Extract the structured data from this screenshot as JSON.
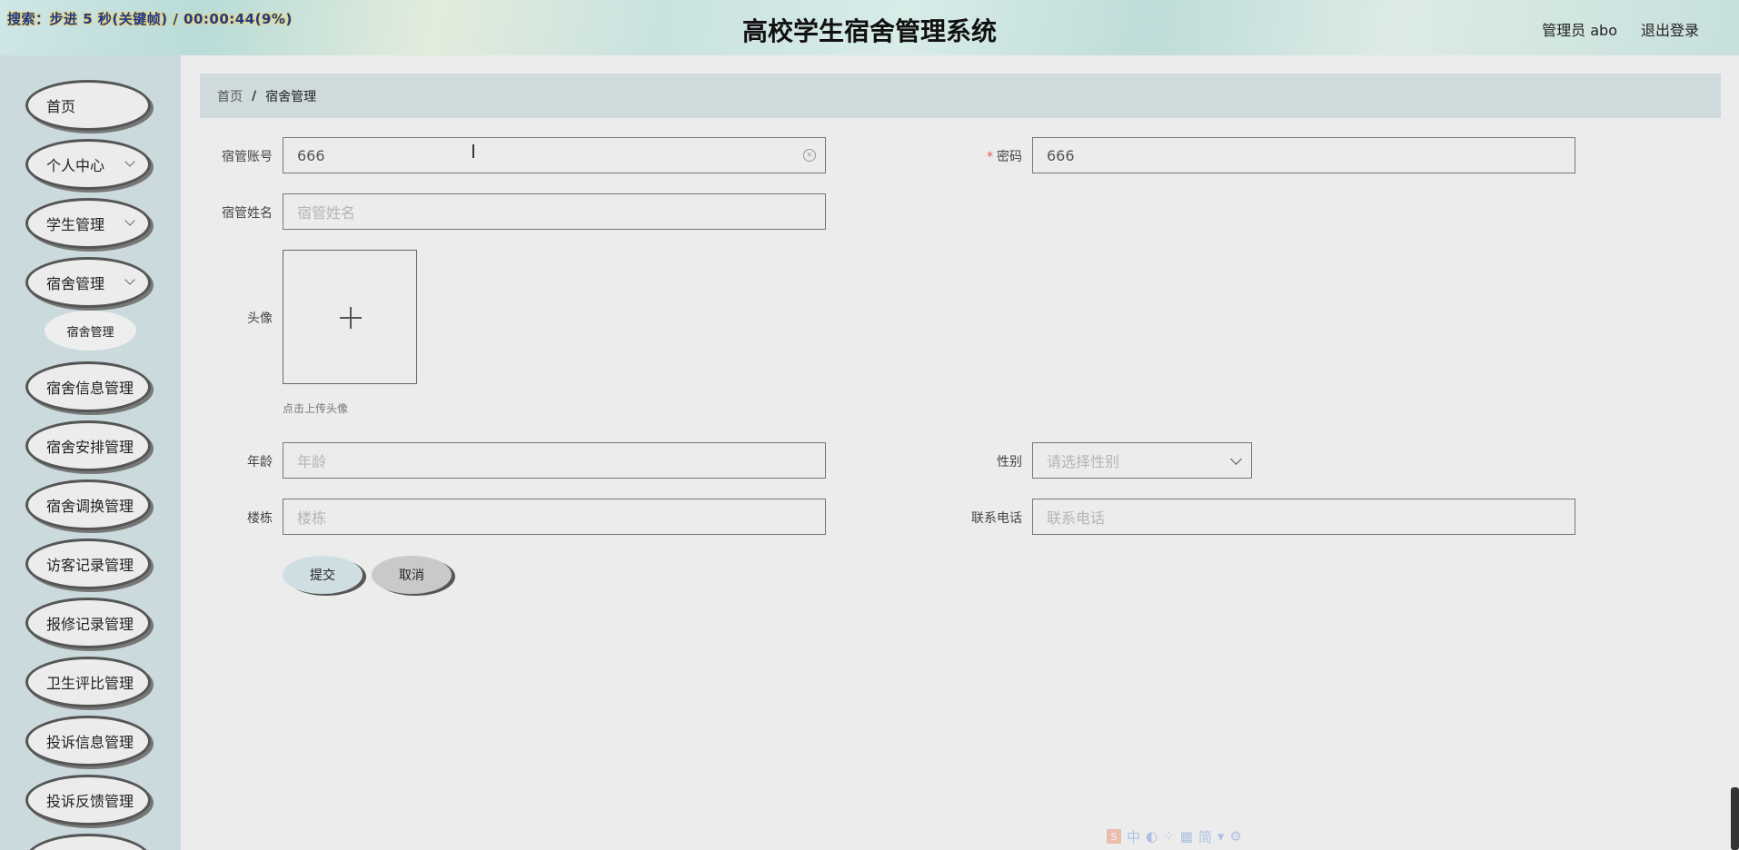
{
  "header": {
    "recorder_text": "搜索：步进 5 秒(关键帧) / 00:00:44(9%)",
    "title": "高校学生宿舍管理系统",
    "user": "管理员 abo",
    "logout": "退出登录"
  },
  "sidebar": {
    "items": [
      {
        "label": "首页"
      },
      {
        "label": "个人中心"
      },
      {
        "label": "学生管理"
      },
      {
        "label": "宿舍管理"
      },
      {
        "label": "宿舍信息管理"
      },
      {
        "label": "宿舍安排管理"
      },
      {
        "label": "宿舍调换管理"
      },
      {
        "label": "访客记录管理"
      },
      {
        "label": "报修记录管理"
      },
      {
        "label": "卫生评比管理"
      },
      {
        "label": "投诉信息管理"
      },
      {
        "label": "投诉反馈管理"
      }
    ],
    "submenu_label": "宿舍管理"
  },
  "breadcrumb": {
    "home": "首页",
    "separator": "/",
    "current": "宿舍管理"
  },
  "form": {
    "account": {
      "label": "宿管账号",
      "value": "666"
    },
    "password": {
      "label": "密码",
      "required_mark": "*",
      "value": "666"
    },
    "name": {
      "label": "宿管姓名",
      "placeholder": "宿管姓名"
    },
    "avatar": {
      "label": "头像",
      "hint": "点击上传头像"
    },
    "age": {
      "label": "年龄",
      "placeholder": "年龄"
    },
    "gender": {
      "label": "性别",
      "placeholder": "请选择性别"
    },
    "building": {
      "label": "楼栋",
      "placeholder": "楼栋"
    },
    "phone": {
      "label": "联系电话",
      "placeholder": "联系电话"
    },
    "submit": "提交",
    "cancel": "取消"
  },
  "ime": {
    "logo": "S",
    "mode": "中",
    "script": "简"
  },
  "colors": {
    "sidebar_bg": "#cbdadd",
    "breadcrumb_bg": "#cfdadd",
    "page_bg": "#ececec",
    "required": "#e55555"
  }
}
